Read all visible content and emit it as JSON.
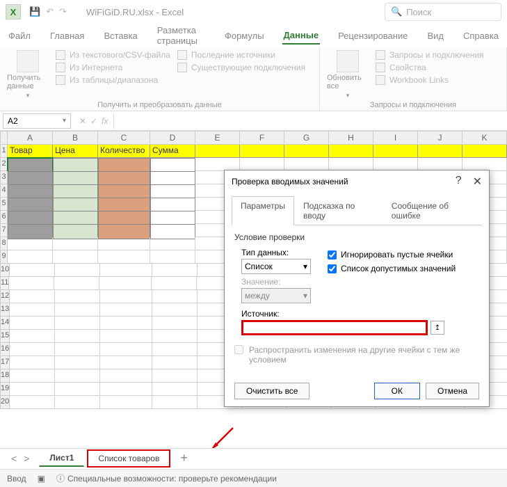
{
  "title": {
    "doc": "WiFiGiD.RU.xlsx - Excel",
    "search_placeholder": "Поиск"
  },
  "tabs": [
    "Файл",
    "Главная",
    "Вставка",
    "Разметка страницы",
    "Формулы",
    "Данные",
    "Рецензирование",
    "Вид",
    "Справка"
  ],
  "active_tab": "Данные",
  "ribbon": {
    "grp1": {
      "big": "Получить данные",
      "items": [
        "Из текстового/CSV-файла",
        "Из Интернета",
        "Из таблицы/диапазона",
        "Последние источники",
        "Существующие подключения"
      ],
      "label": "Получить и преобразовать данные"
    },
    "grp2": {
      "big": "Обновить все",
      "items": [
        "Запросы и подключения",
        "Свойства",
        "Workbook Links"
      ],
      "label": "Запросы и подключения"
    }
  },
  "namebox": "A2",
  "cols": [
    "A",
    "B",
    "C",
    "D",
    "E",
    "F",
    "G",
    "H",
    "I",
    "J",
    "K"
  ],
  "headers": [
    "Товар",
    "Цена",
    "Количество",
    "Сумма"
  ],
  "rows": 20,
  "dialog": {
    "title": "Проверка вводимых значений",
    "tabs": [
      "Параметры",
      "Подсказка по вводу",
      "Сообщение об ошибке"
    ],
    "fieldset": "Условие проверки",
    "type_label": "Тип данных:",
    "type_value": "Список",
    "value_label": "Значение:",
    "value_value": "между",
    "source_label": "Источник:",
    "source_value": "",
    "chk1": "Игнорировать пустые ячейки",
    "chk2": "Список допустимых значений",
    "spread": "Распространить изменения на другие ячейки с тем же условием",
    "clear": "Очистить все",
    "ok": "ОК",
    "cancel": "Отмена"
  },
  "sheets": {
    "s1": "Лист1",
    "s2": "Список товаров"
  },
  "status": {
    "mode": "Ввод",
    "acc": "Специальные возможности: проверьте рекомендации"
  }
}
